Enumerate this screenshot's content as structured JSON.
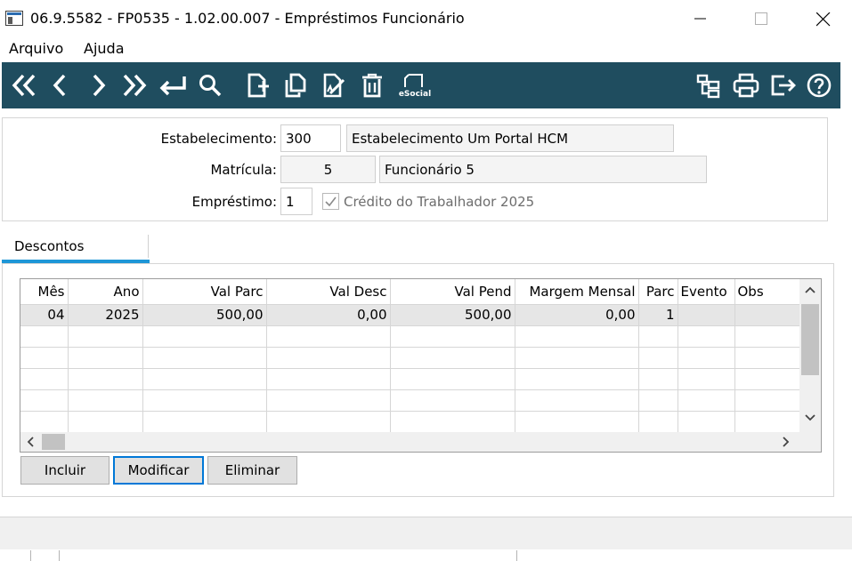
{
  "window": {
    "title": "06.9.5582 - FP0535 - 1.02.00.007 - Empréstimos Funcionário",
    "icons": [
      "app-icon",
      "minimize-icon",
      "maximize-icon",
      "close-icon"
    ]
  },
  "menu": {
    "items": [
      "Arquivo",
      "Ajuda"
    ]
  },
  "toolbar": {
    "color": "#1f4d5f",
    "esocial_label": "eSocial",
    "buttons": [
      "first-record-icon",
      "previous-record-icon",
      "next-record-icon",
      "last-record-icon",
      "goto-icon",
      "search-icon",
      "new-icon",
      "copy-icon",
      "edit-icon",
      "delete-icon",
      "esocial-icon",
      "hierarchy-icon",
      "print-icon",
      "exit-icon",
      "help-icon"
    ]
  },
  "form": {
    "estabelecimento": {
      "label": "Estabelecimento:",
      "code": "300",
      "name": "Estabelecimento Um Portal HCM"
    },
    "matricula": {
      "label": "Matrícula:",
      "code": "5",
      "name": "Funcionário 5"
    },
    "emprestimo": {
      "label": "Empréstimo:",
      "value": "1",
      "checkbox_label": "Crédito do Trabalhador 2025",
      "checked": true
    }
  },
  "tabs": [
    {
      "label": "Descontos",
      "active": true
    }
  ],
  "grid": {
    "columns": [
      "Mês",
      "Ano",
      "Val Parc",
      "Val Desc",
      "Val Pend",
      "Margem Mensal",
      "Parc",
      "Evento",
      "Obs"
    ],
    "rows": [
      {
        "mes": "04",
        "ano": "2025",
        "val_parc": "500,00",
        "val_desc": "0,00",
        "val_pend": "500,00",
        "margem_mensal": "0,00",
        "parc": "1",
        "evento": "",
        "obs": ""
      }
    ]
  },
  "buttons": {
    "incluir": "Incluir",
    "modificar": "Modificar",
    "eliminar": "Eliminar"
  },
  "colors": {
    "accent": "#1e96d7",
    "focus": "#0078d7"
  }
}
